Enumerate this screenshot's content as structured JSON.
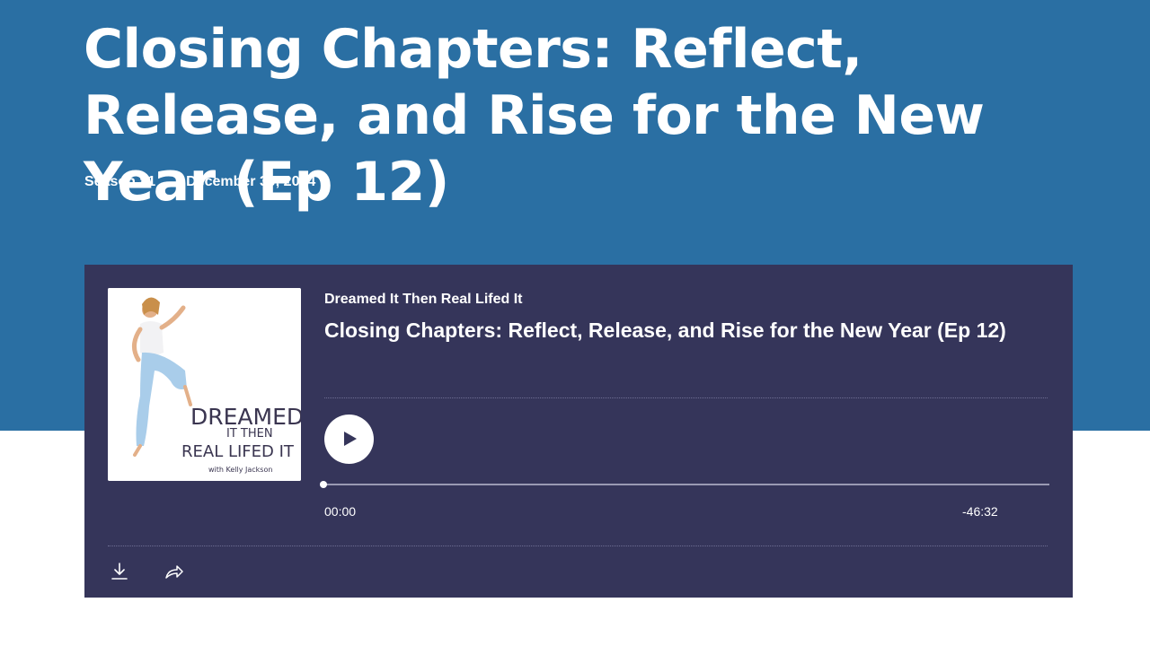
{
  "episode": {
    "title": "Closing Chapters: Reflect, Release, and Rise for the New Year (Ep 12)",
    "season": "Season #1",
    "date": "December 30, 2024"
  },
  "player": {
    "show_name": "Dreamed It Then Real Lifed It",
    "episode_title": "Closing Chapters: Reflect, Release, and Rise for the New Year (Ep 12)",
    "time_elapsed": "00:00",
    "time_remaining": "-46:32",
    "progress_fraction": 0,
    "cover": {
      "line1": "DREAMED",
      "line2": "IT THEN",
      "line3": "REAL LIFED IT",
      "line4": "with Kelly Jackson"
    },
    "icons": {
      "play": "play-icon",
      "download": "download-icon",
      "share": "share-icon"
    }
  },
  "colors": {
    "hero_background": "#2a6fa3",
    "player_background": "#35355a",
    "text": "#ffffff"
  }
}
